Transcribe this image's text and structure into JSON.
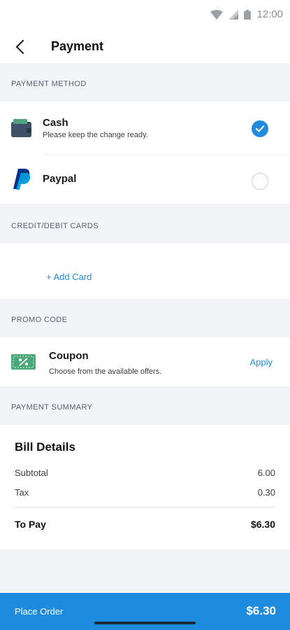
{
  "status_bar": {
    "time": "12:00"
  },
  "header": {
    "title": "Payment"
  },
  "payment_method": {
    "section_label": "PAYMENT METHOD",
    "options": [
      {
        "label": "Cash",
        "sublabel": "Please keep the change ready.",
        "selected": true
      },
      {
        "label": "Paypal",
        "sublabel": "",
        "selected": false
      }
    ]
  },
  "cards": {
    "section_label": "CREDIT/DEBIT CARDS",
    "add_label": "+ Add Card"
  },
  "promo": {
    "section_label": "PROMO CODE",
    "title": "Coupon",
    "sublabel": "Choose from the available offers.",
    "apply_label": "Apply"
  },
  "summary": {
    "section_label": "PAYMENT SUMMARY",
    "title": "Bill Details",
    "rows": [
      {
        "label": "Subtotal",
        "value": "6.00"
      },
      {
        "label": "Tax",
        "value": "0.30"
      }
    ],
    "total_label": "To Pay",
    "total_value": "$6.30"
  },
  "footer": {
    "button_label": "Place Order",
    "amount": "$6.30"
  },
  "colors": {
    "accent": "#1e8bde",
    "background": "#f2f4f7",
    "paypal_dark": "#003087",
    "paypal_light": "#009cde",
    "coupon_green": "#49a779"
  }
}
